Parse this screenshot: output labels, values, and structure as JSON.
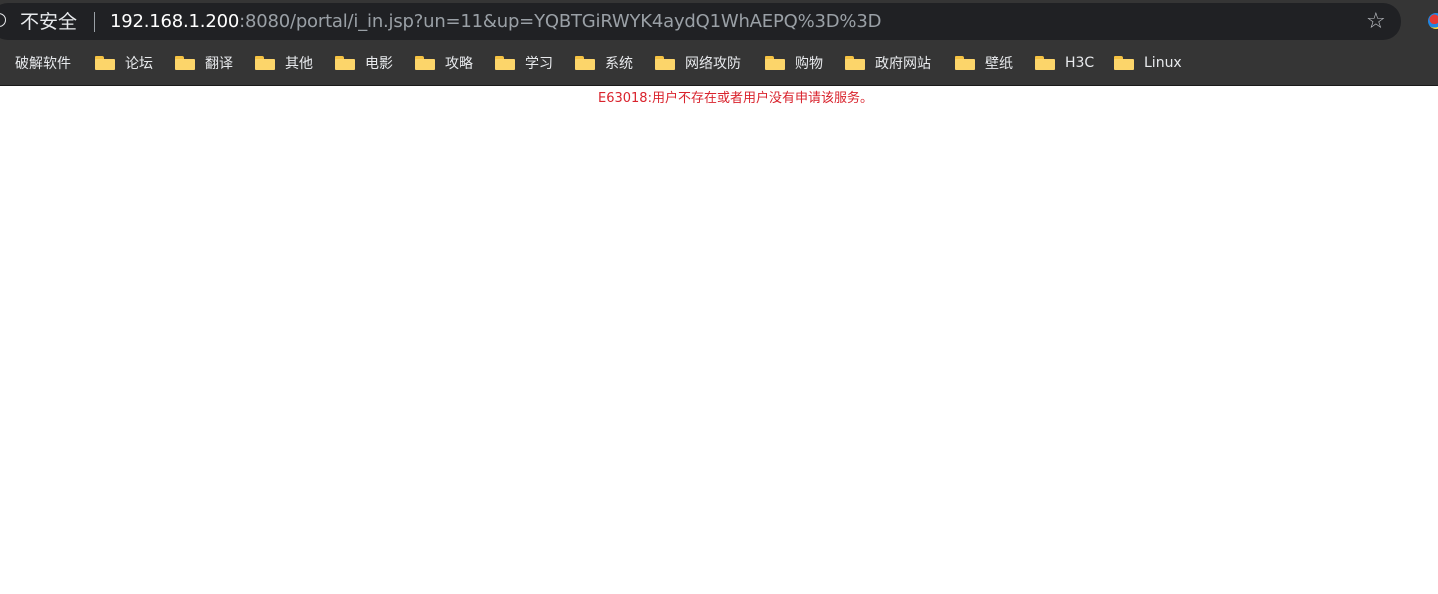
{
  "browser": {
    "security_label": "不安全",
    "url_host": "192.168.1.200",
    "url_rest": ":8080/portal/i_in.jsp?un=11&up=YQBTGiRWYK4aydQ1WhAEPQ%3D%3D",
    "icons": {
      "info": "info-icon",
      "star": "bookmark-star-icon",
      "extension": "extension-icon",
      "folder": "folder-icon"
    },
    "bookmarks": [
      {
        "label": "破解软件",
        "folder": false
      },
      {
        "label": "论坛",
        "folder": true
      },
      {
        "label": "翻译",
        "folder": true
      },
      {
        "label": "其他",
        "folder": true
      },
      {
        "label": "电影",
        "folder": true
      },
      {
        "label": "攻略",
        "folder": true
      },
      {
        "label": "学习",
        "folder": true
      },
      {
        "label": "系统",
        "folder": true
      },
      {
        "label": "网络攻防",
        "folder": true
      },
      {
        "label": "购物",
        "folder": true
      },
      {
        "label": "政府网站",
        "folder": true
      },
      {
        "label": "壁纸",
        "folder": true
      },
      {
        "label": "H3C",
        "folder": true
      },
      {
        "label": "Linux",
        "folder": true
      }
    ]
  },
  "page": {
    "error_message": "E63018:用户不存在或者用户没有申请该服务。"
  },
  "colors": {
    "chrome_bg": "#353535",
    "omnibox_bg": "#202124",
    "error_text": "#d9232d",
    "folder": "#fcd56a"
  }
}
